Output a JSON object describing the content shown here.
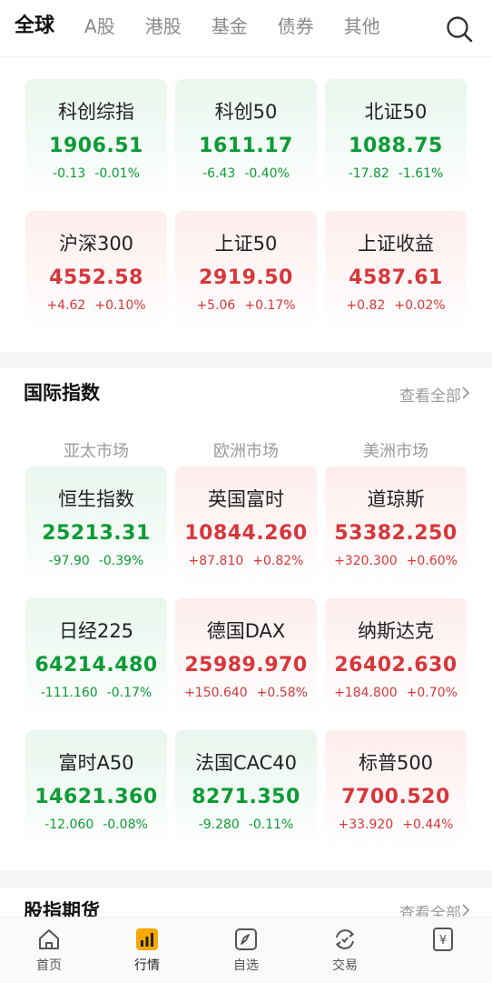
{
  "tabs": [
    "全球",
    "A股",
    "港股",
    "基金",
    "债券",
    "其他"
  ],
  "active_tab": "全球",
  "domestic": [
    {
      "name": "科创综指",
      "price": "1906.51",
      "change": "-0.13",
      "pct": "-0.01%",
      "trend": "down"
    },
    {
      "name": "科创50",
      "price": "1611.17",
      "change": "-6.43",
      "pct": "-0.40%",
      "trend": "down"
    },
    {
      "name": "北证50",
      "price": "1088.75",
      "change": "-17.82",
      "pct": "-1.61%",
      "trend": "down"
    },
    {
      "name": "沪深300",
      "price": "4552.58",
      "change": "+4.62",
      "pct": "+0.10%",
      "trend": "up"
    },
    {
      "name": "上证50",
      "price": "2919.50",
      "change": "+5.06",
      "pct": "+0.17%",
      "trend": "up"
    },
    {
      "name": "上证收益",
      "price": "4587.61",
      "change": "+0.82",
      "pct": "+0.02%",
      "trend": "up"
    }
  ],
  "international": {
    "title": "国际指数",
    "more": "查看全部",
    "markets": [
      "亚太市场",
      "欧洲市场",
      "美洲市场"
    ],
    "items": [
      {
        "name": "恒生指数",
        "price": "25213.31",
        "change": "-97.90",
        "pct": "-0.39%",
        "trend": "down"
      },
      {
        "name": "英国富时",
        "price": "10844.260",
        "change": "+87.810",
        "pct": "+0.82%",
        "trend": "up"
      },
      {
        "name": "道琼斯",
        "price": "53382.250",
        "change": "+320.300",
        "pct": "+0.60%",
        "trend": "up"
      },
      {
        "name": "日经225",
        "price": "64214.480",
        "change": "-111.160",
        "pct": "-0.17%",
        "trend": "down"
      },
      {
        "name": "德国DAX",
        "price": "25989.970",
        "change": "+150.640",
        "pct": "+0.58%",
        "trend": "up"
      },
      {
        "name": "纳斯达克",
        "price": "26402.630",
        "change": "+184.800",
        "pct": "+0.70%",
        "trend": "up"
      },
      {
        "name": "富时A50",
        "price": "14621.360",
        "change": "-12.060",
        "pct": "-0.08%",
        "trend": "down"
      },
      {
        "name": "法国CAC40",
        "price": "8271.350",
        "change": "-9.280",
        "pct": "-0.11%",
        "trend": "down"
      },
      {
        "name": "标普500",
        "price": "7700.520",
        "change": "+33.920",
        "pct": "+0.44%",
        "trend": "up"
      }
    ]
  },
  "futures": {
    "title": "股指期货",
    "more": "查看全部"
  },
  "bottom_nav": [
    {
      "label": "首页",
      "icon": "home-icon"
    },
    {
      "label": "行情",
      "icon": "market-icon"
    },
    {
      "label": "自选",
      "icon": "watchlist-icon"
    },
    {
      "label": "交易",
      "icon": "trade-icon"
    },
    {
      "label": "",
      "icon": "wallet-icon"
    }
  ],
  "colors": {
    "up": "#d6373b",
    "down": "#0c9b36",
    "accent": "#f5a800"
  }
}
